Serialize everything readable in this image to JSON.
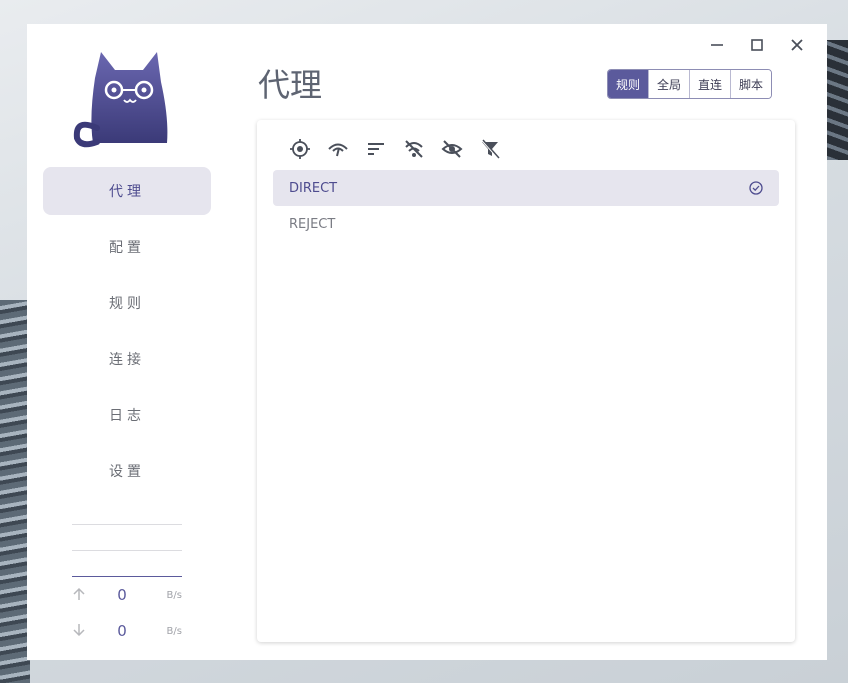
{
  "window": {
    "controls": [
      {
        "name": "minimize-icon"
      },
      {
        "name": "maximize-icon"
      },
      {
        "name": "close-icon"
      }
    ]
  },
  "sidebar": {
    "items": [
      {
        "label": "代理",
        "active": true
      },
      {
        "label": "配置",
        "active": false
      },
      {
        "label": "规则",
        "active": false
      },
      {
        "label": "连接",
        "active": false
      },
      {
        "label": "日志",
        "active": false
      },
      {
        "label": "设置",
        "active": false
      }
    ]
  },
  "traffic": {
    "upload": {
      "value": "0",
      "unit": "B/s"
    },
    "download": {
      "value": "0",
      "unit": "B/s"
    }
  },
  "header": {
    "title": "代理",
    "modes": [
      {
        "label": "规则",
        "active": true
      },
      {
        "label": "全局",
        "active": false
      },
      {
        "label": "直连",
        "active": false
      },
      {
        "label": "脚本",
        "active": false
      }
    ]
  },
  "toolbar": {
    "icons": [
      "locate-icon",
      "speed-test-icon",
      "sort-icon",
      "latency-off-icon",
      "hide-icon",
      "filter-off-icon"
    ]
  },
  "proxies": [
    {
      "name": "DIRECT",
      "selected": true
    },
    {
      "name": "REJECT",
      "selected": false
    }
  ],
  "colors": {
    "accent": "#5b5a9c",
    "selected_bg": "#e6e5ee"
  }
}
